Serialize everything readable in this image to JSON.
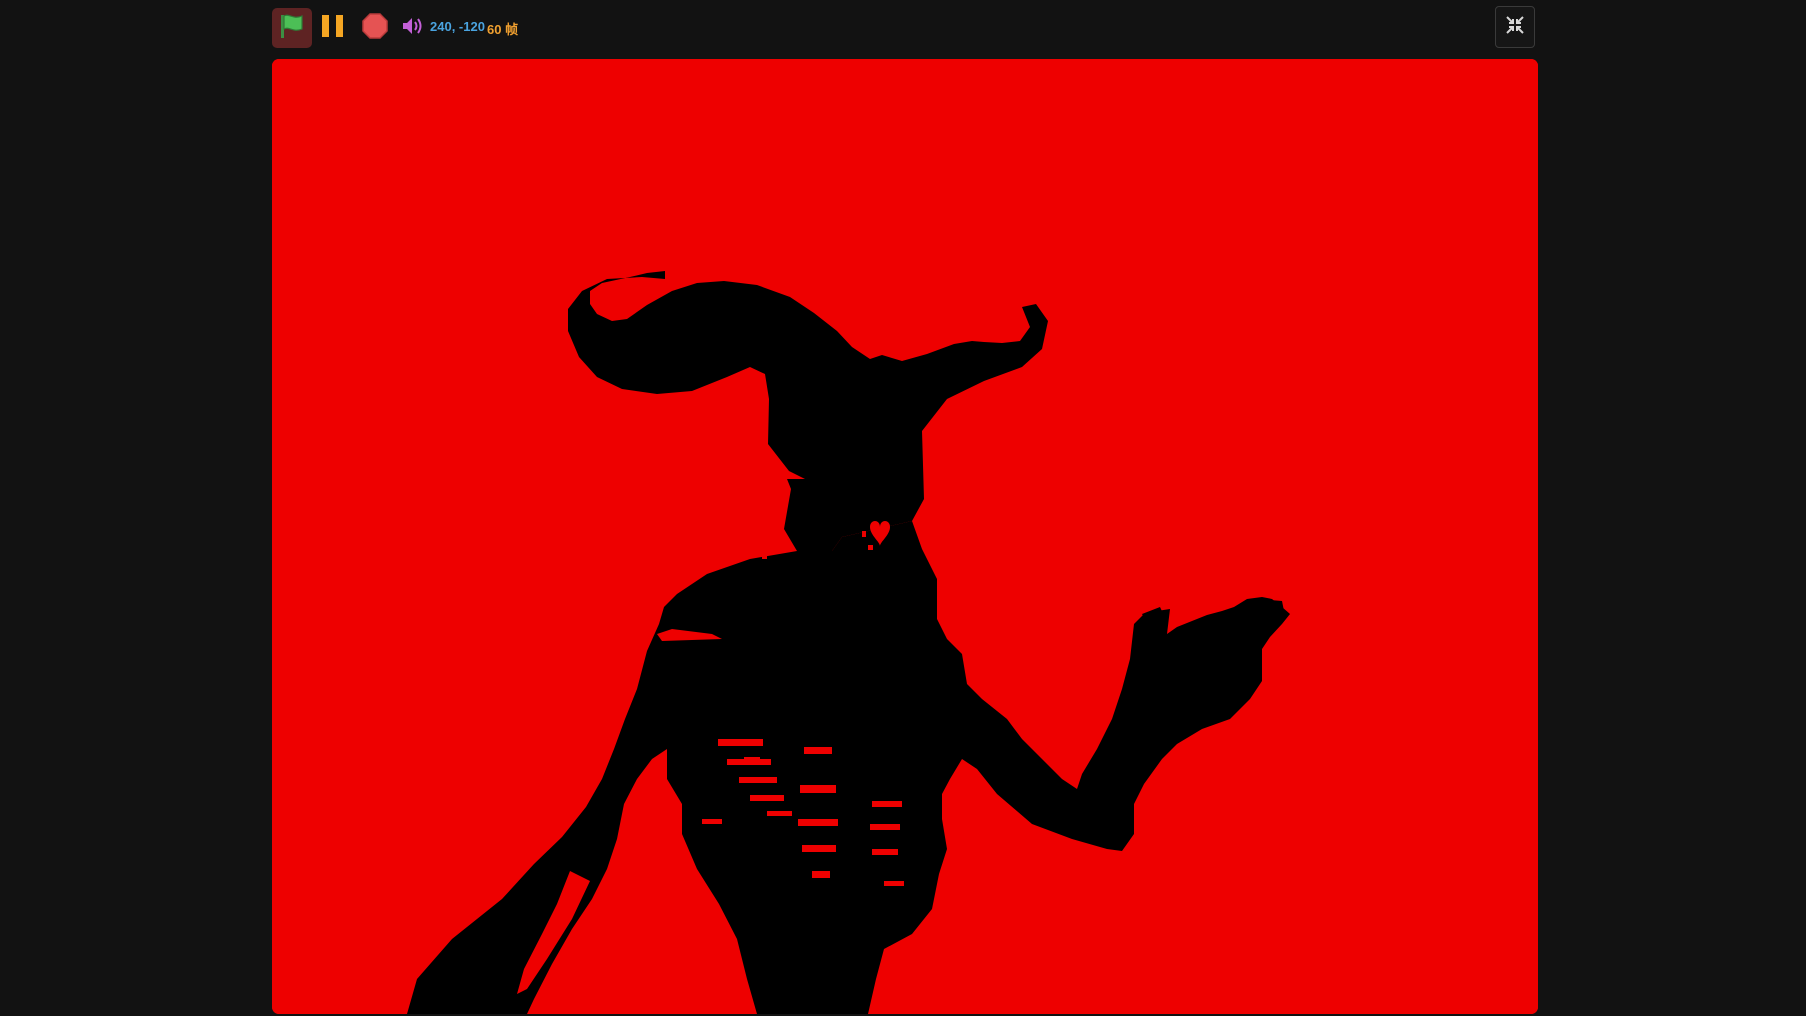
{
  "toolbar": {
    "green_flag_icon": "green-flag-icon",
    "pause_icon": "pause-icon",
    "stop_icon": "stop-sign-icon",
    "sound_icon": "speaker-icon",
    "mouse_coordinates": "240, -120",
    "fps_label": "60 帧",
    "fullscreen_icon": "exit-fullscreen-icon"
  },
  "stage": {
    "background_color": "#ee0000",
    "sprite": "horned-skeleton-demon-silhouette",
    "heart_icon": "heart-icon"
  },
  "colors": {
    "page_background": "#121212",
    "flag_green": "#4cbf56",
    "pause_orange": "#f5a623",
    "stop_red": "#e55353",
    "sound_purple": "#c460d8",
    "coords_blue": "#4aa3df",
    "fps_orange": "#f0a030"
  }
}
